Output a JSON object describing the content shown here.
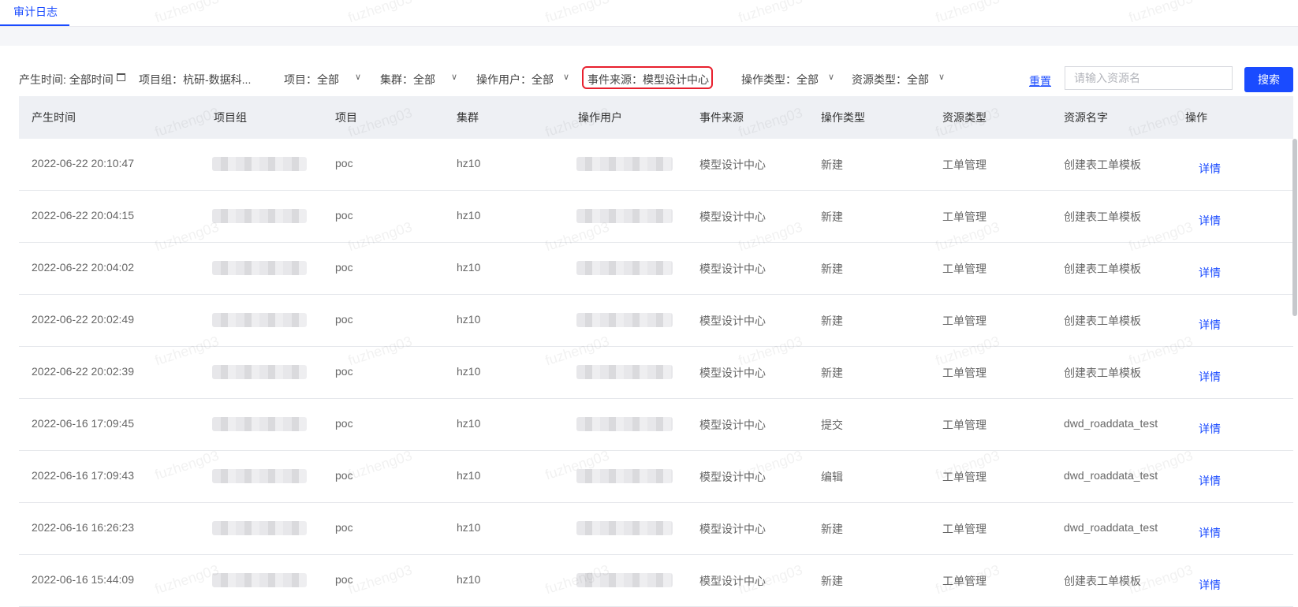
{
  "tab": {
    "label": "审计日志"
  },
  "filters": {
    "time": "产生时间: 全部时间",
    "group": "项目组：杭研-数据科...",
    "project": "项目：全部",
    "cluster": "集群：全部",
    "user": "操作用户：全部",
    "source": "事件来源：模型设计中心",
    "op_type": "操作类型：全部",
    "res_type": "资源类型：全部",
    "reset_label": "重置",
    "search_placeholder": "请输入资源名",
    "search_label": "搜索",
    "highlight_color": "#e8202e",
    "accent_color": "#1a4bff"
  },
  "table": {
    "columns": [
      "产生时间",
      "项目组",
      "项目",
      "集群",
      "操作用户",
      "事件来源",
      "操作类型",
      "资源类型",
      "资源名字",
      "操作"
    ],
    "rows": [
      {
        "time": "2022-06-22 20:10:47",
        "project": "poc",
        "cluster": "hz10",
        "source": "模型设计中心",
        "op_type": "新建",
        "res_type": "工单管理",
        "res_name": "创建表工单模板",
        "action": "详情"
      },
      {
        "time": "2022-06-22 20:04:15",
        "project": "poc",
        "cluster": "hz10",
        "source": "模型设计中心",
        "op_type": "新建",
        "res_type": "工单管理",
        "res_name": "创建表工单模板",
        "action": "详情"
      },
      {
        "time": "2022-06-22 20:04:02",
        "project": "poc",
        "cluster": "hz10",
        "source": "模型设计中心",
        "op_type": "新建",
        "res_type": "工单管理",
        "res_name": "创建表工单模板",
        "action": "详情"
      },
      {
        "time": "2022-06-22 20:02:49",
        "project": "poc",
        "cluster": "hz10",
        "source": "模型设计中心",
        "op_type": "新建",
        "res_type": "工单管理",
        "res_name": "创建表工单模板",
        "action": "详情"
      },
      {
        "time": "2022-06-22 20:02:39",
        "project": "poc",
        "cluster": "hz10",
        "source": "模型设计中心",
        "op_type": "新建",
        "res_type": "工单管理",
        "res_name": "创建表工单模板",
        "action": "详情"
      },
      {
        "time": "2022-06-16 17:09:45",
        "project": "poc",
        "cluster": "hz10",
        "source": "模型设计中心",
        "op_type": "提交",
        "res_type": "工单管理",
        "res_name": "dwd_roaddata_test",
        "action": "详情"
      },
      {
        "time": "2022-06-16 17:09:43",
        "project": "poc",
        "cluster": "hz10",
        "source": "模型设计中心",
        "op_type": "编辑",
        "res_type": "工单管理",
        "res_name": "dwd_roaddata_test",
        "action": "详情"
      },
      {
        "time": "2022-06-16 16:26:23",
        "project": "poc",
        "cluster": "hz10",
        "source": "模型设计中心",
        "op_type": "新建",
        "res_type": "工单管理",
        "res_name": "dwd_roaddata_test",
        "action": "详情"
      },
      {
        "time": "2022-06-16 15:44:09",
        "project": "poc",
        "cluster": "hz10",
        "source": "模型设计中心",
        "op_type": "新建",
        "res_type": "工单管理",
        "res_name": "创建表工单模板",
        "action": "详情"
      }
    ]
  },
  "watermark": "fuzheng03"
}
